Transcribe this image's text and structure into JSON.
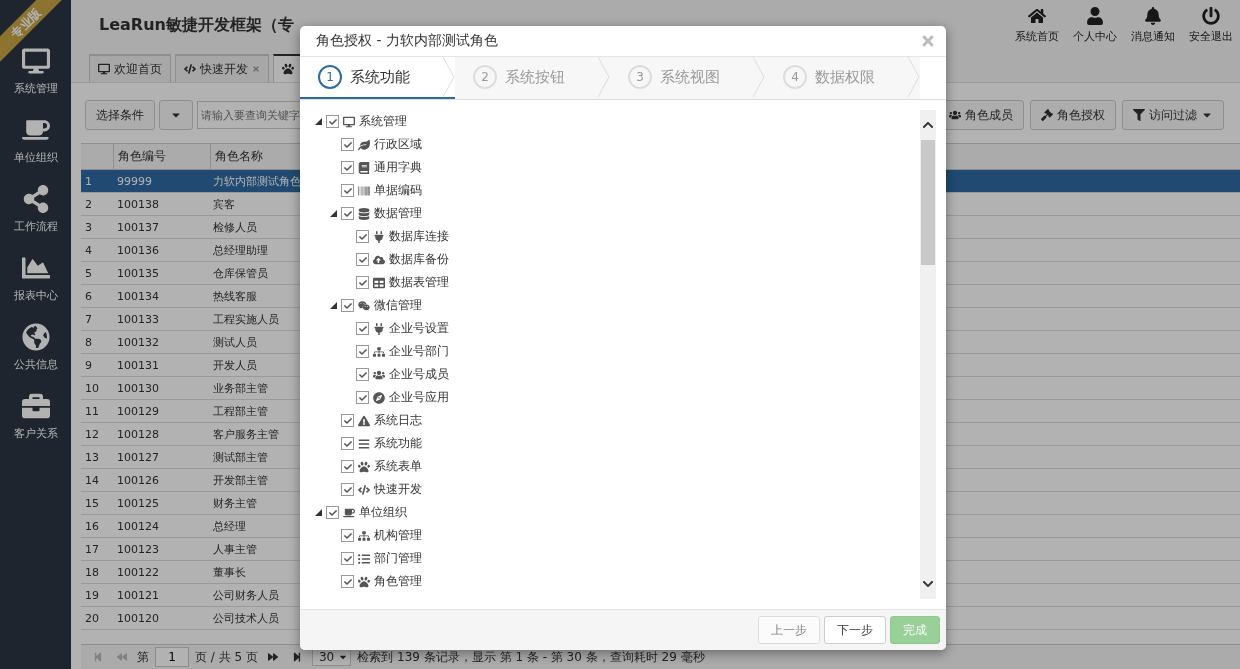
{
  "sidebar": {
    "badge": "专业版",
    "items": [
      {
        "label": "系统管理"
      },
      {
        "label": "单位组织"
      },
      {
        "label": "工作流程"
      },
      {
        "label": "报表中心"
      },
      {
        "label": "公共信息"
      },
      {
        "label": "客户关系"
      }
    ]
  },
  "header": {
    "title": "LeaRun敏捷开发框架（专",
    "actions": [
      {
        "label": "系统首页"
      },
      {
        "label": "个人中心"
      },
      {
        "label": "消息通知"
      },
      {
        "label": "安全退出"
      }
    ]
  },
  "tabs": [
    {
      "label": "欢迎首页",
      "selected": false,
      "closable": false
    },
    {
      "label": "快速开发",
      "selected": false,
      "closable": true
    },
    {
      "selected": true,
      "closable": false
    }
  ],
  "toolbar": {
    "condition": "选择条件",
    "search": {
      "placeholder": "请输入要查询关键字"
    },
    "buttons": [
      {
        "label": "角色成员",
        "dropdown": false
      },
      {
        "label": "角色授权",
        "dropdown": false
      },
      {
        "label": "访问过滤",
        "dropdown": true
      }
    ]
  },
  "grid": {
    "columns": [
      "角色编号",
      "角色名称"
    ],
    "rows": [
      {
        "index": "1",
        "code": "99999",
        "name": "力软内部测试角色",
        "selected": true
      },
      {
        "index": "2",
        "code": "100138",
        "name": "宾客",
        "selected": false
      },
      {
        "index": "3",
        "code": "100137",
        "name": "检修人员",
        "selected": false
      },
      {
        "index": "4",
        "code": "100136",
        "name": "总经理助理",
        "selected": false
      },
      {
        "index": "5",
        "code": "100135",
        "name": "仓库保管员",
        "selected": false
      },
      {
        "index": "6",
        "code": "100134",
        "name": "热线客服",
        "selected": false
      },
      {
        "index": "7",
        "code": "100133",
        "name": "工程实施人员",
        "selected": false
      },
      {
        "index": "8",
        "code": "100132",
        "name": "测试人员",
        "selected": false
      },
      {
        "index": "9",
        "code": "100131",
        "name": "开发人员",
        "selected": false
      },
      {
        "index": "10",
        "code": "100130",
        "name": "业务部主管",
        "selected": false
      },
      {
        "index": "11",
        "code": "100129",
        "name": "工程部主管",
        "selected": false
      },
      {
        "index": "12",
        "code": "100128",
        "name": "客户服务主管",
        "selected": false
      },
      {
        "index": "13",
        "code": "100127",
        "name": "测试部主管",
        "selected": false
      },
      {
        "index": "14",
        "code": "100126",
        "name": "开发部主管",
        "selected": false
      },
      {
        "index": "15",
        "code": "100125",
        "name": "财务主管",
        "selected": false
      },
      {
        "index": "16",
        "code": "100124",
        "name": "总经理",
        "selected": false
      },
      {
        "index": "17",
        "code": "100123",
        "name": "人事主管",
        "selected": false
      },
      {
        "index": "18",
        "code": "100122",
        "name": "董事长",
        "selected": false
      },
      {
        "index": "19",
        "code": "100121",
        "name": "公司财务人员",
        "selected": false
      },
      {
        "index": "20",
        "code": "100120",
        "name": "公司技术人员",
        "selected": false
      }
    ]
  },
  "pager": {
    "page_prefix": "第",
    "page": "1",
    "page_suffix": "页 / 共 5 页",
    "page_size": "30",
    "summary": "检索到 139 条记录，显示 第 1 条 - 第 30 条，查询耗时 29 毫秒"
  },
  "dialog": {
    "title": "角色授权 - 力软内部测试角色",
    "steps": [
      {
        "number": "1",
        "label": "系统功能",
        "selected": true
      },
      {
        "number": "2",
        "label": "系统按钮",
        "selected": false
      },
      {
        "number": "3",
        "label": "系统视图",
        "selected": false
      },
      {
        "number": "4",
        "label": "数据权限",
        "selected": false
      }
    ],
    "tree": [
      {
        "label": "系统管理",
        "checked": true,
        "expanded": true,
        "children": [
          {
            "label": "行政区域",
            "checked": true
          },
          {
            "label": "通用字典",
            "checked": true
          },
          {
            "label": "单据编码",
            "checked": true
          },
          {
            "label": "数据管理",
            "checked": true,
            "expanded": true,
            "children": [
              {
                "label": "数据库连接",
                "checked": true
              },
              {
                "label": "数据库备份",
                "checked": true
              },
              {
                "label": "数据表管理",
                "checked": true
              }
            ]
          },
          {
            "label": "微信管理",
            "checked": true,
            "expanded": true,
            "children": [
              {
                "label": "企业号设置",
                "checked": true
              },
              {
                "label": "企业号部门",
                "checked": true
              },
              {
                "label": "企业号成员",
                "checked": true
              },
              {
                "label": "企业号应用",
                "checked": true
              }
            ]
          },
          {
            "label": "系统日志",
            "checked": true
          },
          {
            "label": "系统功能",
            "checked": true
          },
          {
            "label": "系统表单",
            "checked": true
          },
          {
            "label": "快速开发",
            "checked": true
          }
        ]
      },
      {
        "label": "单位组织",
        "checked": true,
        "expanded": true,
        "children": [
          {
            "label": "机构管理",
            "checked": true
          },
          {
            "label": "部门管理",
            "checked": true
          },
          {
            "label": "角色管理",
            "checked": true
          }
        ]
      }
    ],
    "buttons": [
      {
        "label": "上一步",
        "kind": "default",
        "disabled": true
      },
      {
        "label": "下一步",
        "kind": "default",
        "disabled": false
      },
      {
        "label": "完成",
        "kind": "primary",
        "disabled": true
      }
    ]
  }
}
